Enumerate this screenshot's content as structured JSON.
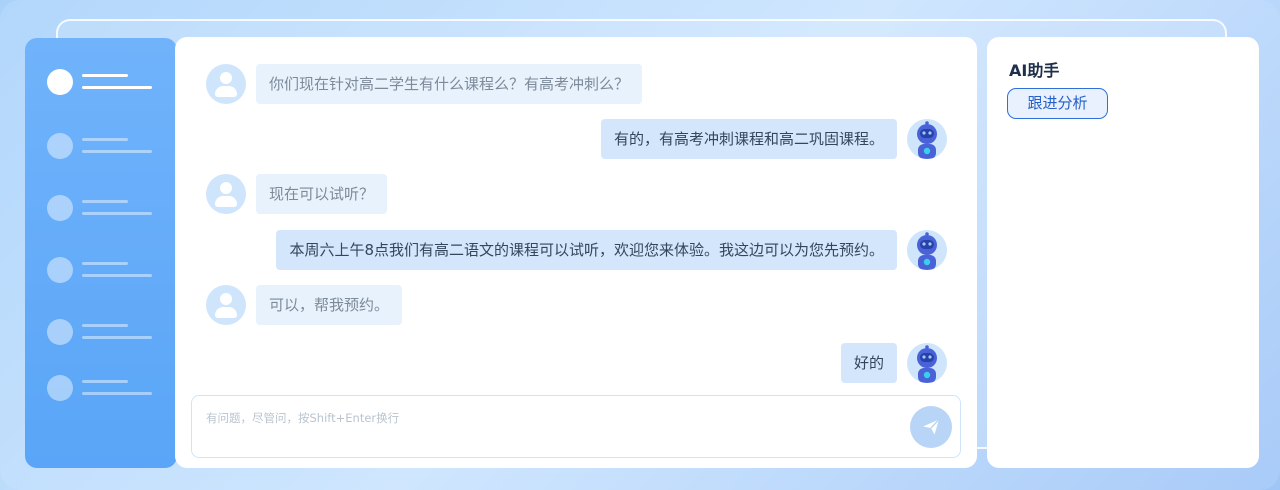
{
  "sidebar": {
    "items": [
      {
        "name": "nav-item-1",
        "active": true
      },
      {
        "name": "nav-item-2",
        "active": false
      },
      {
        "name": "nav-item-3",
        "active": false
      },
      {
        "name": "nav-item-4",
        "active": false
      },
      {
        "name": "nav-item-5",
        "active": false
      },
      {
        "name": "nav-item-6",
        "active": false
      }
    ]
  },
  "chat": {
    "messages": [
      {
        "role": "user",
        "text": "你们现在针对高二学生有什么课程么？有高考冲刺么？"
      },
      {
        "role": "bot",
        "text": "有的，有高考冲刺课程和高二巩固课程。"
      },
      {
        "role": "user",
        "text": "现在可以试听？"
      },
      {
        "role": "bot",
        "text": "本周六上午8点我们有高二语文的课程可以试听，欢迎您来体验。我这边可以为您先预约。"
      },
      {
        "role": "user",
        "text": "可以，帮我预约。"
      },
      {
        "role": "bot",
        "text": "好的"
      }
    ],
    "input": {
      "placeholder": "有问题，尽管问，按Shift+Enter换行",
      "value": ""
    },
    "send_icon": "send-icon",
    "user_avatar_icon": "user-avatar-icon",
    "bot_avatar_icon": "robot-avatar-icon"
  },
  "panel": {
    "title": "AI助手",
    "tag_label": "跟进分析"
  },
  "colors": {
    "sidebar": "#5aa5f7",
    "accent": "#2f6fdc",
    "bot_bubble": "#d3e6fb",
    "user_bubble": "#e8f2fc"
  }
}
